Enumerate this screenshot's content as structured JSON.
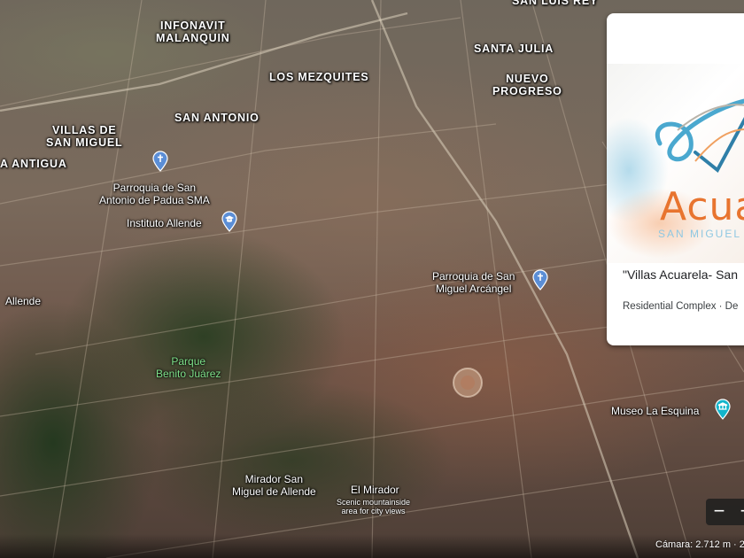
{
  "map": {
    "place_labels": [
      "INFONAVIT\nMALANQUIN",
      "LOS MEZQUITES",
      "SANTA JULIA",
      "NUEVO\nPROGRESO",
      "VILLAS DE\nSAN MIGUEL",
      "SAN ANTONIO",
      "A ANTIGUA",
      "SAN LUIS REY"
    ],
    "pois": {
      "parroquia_padua": "Parroquia de San\nAntonio de Padua SMA",
      "instituto_allende": "Instituto Allende",
      "parroquia_arcangel": "Parroquia de San\nMiguel Arcángel",
      "allende": "Allende",
      "museo_la_esquina": "Museo La Esquina",
      "mirador_san_miguel": "Mirador San\nMiguel de Allende",
      "el_mirador": "El Mirador",
      "el_mirador_desc": "Scenic mountainside\narea for city views"
    },
    "park_label": "Parque\nBenito Juárez",
    "colors": {
      "pin_blue": "#5b8ed6",
      "museum_teal": "#12b5cb",
      "park_green": "#7ee08a"
    }
  },
  "info_card": {
    "brand_word": "Acua",
    "brand_sub": "SAN MIGUEL",
    "title": "\"Villas Acuarela- San",
    "subtitle": "Residential Complex · De",
    "brand_color": "#e8742f"
  },
  "controls": {
    "zoom_out": "−",
    "zoom_in": "+"
  },
  "status": {
    "camera": "Cámara: 2.712 m · 2"
  }
}
